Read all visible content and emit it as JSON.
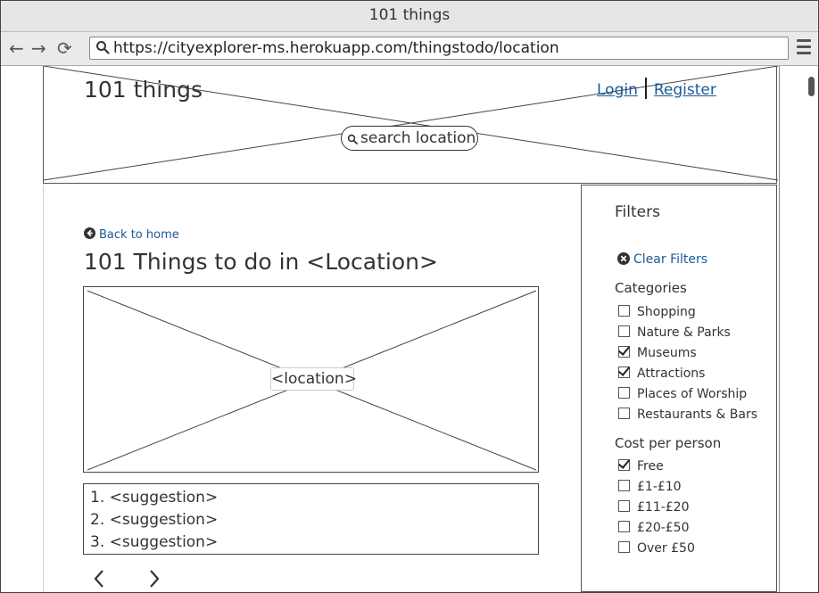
{
  "window": {
    "title": "101 things"
  },
  "browser": {
    "back_icon": "←",
    "forward_icon": "→",
    "reload_icon": "⟳",
    "url": "https://cityexplorer-ms.herokuapp.com/thingstodo/location"
  },
  "header": {
    "brand": "101 things",
    "login": "Login",
    "register": "Register",
    "search_label": "search location"
  },
  "main": {
    "back_link": "Back to home",
    "title": "101 Things to do in <Location>",
    "image_label": "<location>",
    "suggestions": [
      "1. <suggestion>",
      "2. <suggestion>",
      "3. <suggestion>"
    ],
    "prev_icon": "‹",
    "next_icon": "›"
  },
  "filters": {
    "title": "Filters",
    "clear_label": "Clear Filters",
    "categories_heading": "Categories",
    "categories": [
      {
        "label": "Shopping",
        "checked": false
      },
      {
        "label": "Nature & Parks",
        "checked": false
      },
      {
        "label": "Museums",
        "checked": true
      },
      {
        "label": "Attractions",
        "checked": true
      },
      {
        "label": "Places of Worship",
        "checked": false
      },
      {
        "label": "Restaurants & Bars",
        "checked": false
      }
    ],
    "cost_heading": "Cost per person",
    "costs": [
      {
        "label": "Free",
        "checked": true
      },
      {
        "label": "£1-£10",
        "checked": false
      },
      {
        "label": "£11-£20",
        "checked": false
      },
      {
        "label": "£20-£50",
        "checked": false
      },
      {
        "label": "Over £50",
        "checked": false
      }
    ]
  },
  "colors": {
    "link": "#1a5a96",
    "border": "#444444",
    "chrome": "#e6e6e6"
  }
}
